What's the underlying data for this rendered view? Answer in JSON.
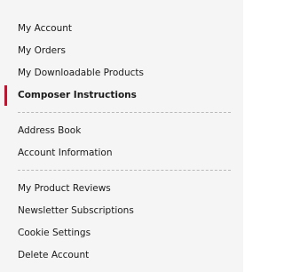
{
  "account_nav": {
    "group1": [
      {
        "label": "My Account"
      },
      {
        "label": "My Orders"
      },
      {
        "label": "My Downloadable Products"
      },
      {
        "label": "Composer Instructions",
        "current": true
      }
    ],
    "group2": [
      {
        "label": "Address Book"
      },
      {
        "label": "Account Information"
      }
    ],
    "group3": [
      {
        "label": "My Product Reviews"
      },
      {
        "label": "Newsletter Subscriptions"
      },
      {
        "label": "Cookie Settings"
      },
      {
        "label": "Delete Account"
      }
    ],
    "colors": {
      "background": "#f5f5f5",
      "active_indicator": "#c8102e",
      "text": "#1a1a1a",
      "divider": "#b9b9b9"
    }
  }
}
